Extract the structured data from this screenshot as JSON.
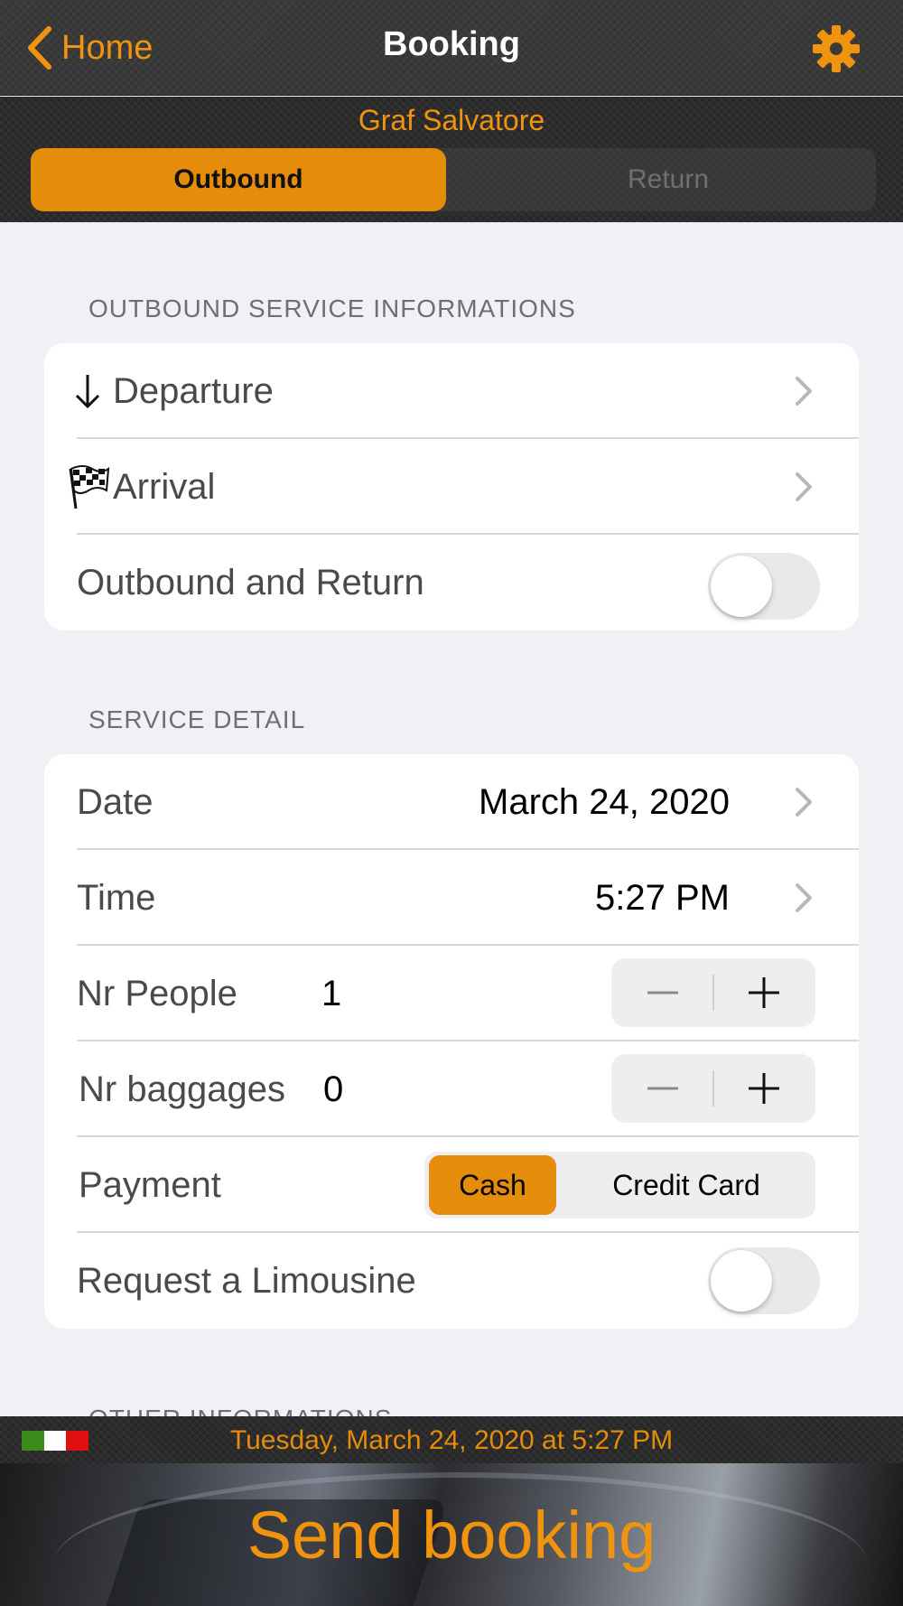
{
  "nav": {
    "back_label": "Home",
    "title": "Booking",
    "settings_icon": "gear-icon"
  },
  "driver_name": "Graf Salvatore",
  "trip_tabs": [
    {
      "label": "Outbound",
      "selected": true
    },
    {
      "label": "Return",
      "selected": false
    }
  ],
  "outbound_section": {
    "header": "OUTBOUND SERVICE INFORMATIONS",
    "departure_label": "Departure",
    "arrival_label": "Arrival",
    "round_trip_label": "Outbound and Return",
    "round_trip_on": false
  },
  "detail_section": {
    "header": "SERVICE DETAIL",
    "date_label": "Date",
    "date_value": "March 24, 2020",
    "time_label": "Time",
    "time_value": "5:27 PM",
    "people_label": "Nr People",
    "people_value": "1",
    "baggages_label": "Nr baggages",
    "baggages_value": "0",
    "payment_label": "Payment",
    "payment_options": [
      "Cash",
      "Credit Card"
    ],
    "payment_selected": "Cash",
    "limousine_label": "Request a Limousine",
    "limousine_on": false
  },
  "next_section_header": "OTHER INFORMATIONS",
  "status": {
    "datetime_text": "Tuesday, March 24, 2020 at 5:27 PM",
    "flag_icon": "italy-flag-icon"
  },
  "send_label": "Send booking",
  "colors": {
    "accent": "#f0940f",
    "segment_active": "#e58c0a",
    "background": "#f0f0f5",
    "bar": "#2c2c2c"
  }
}
